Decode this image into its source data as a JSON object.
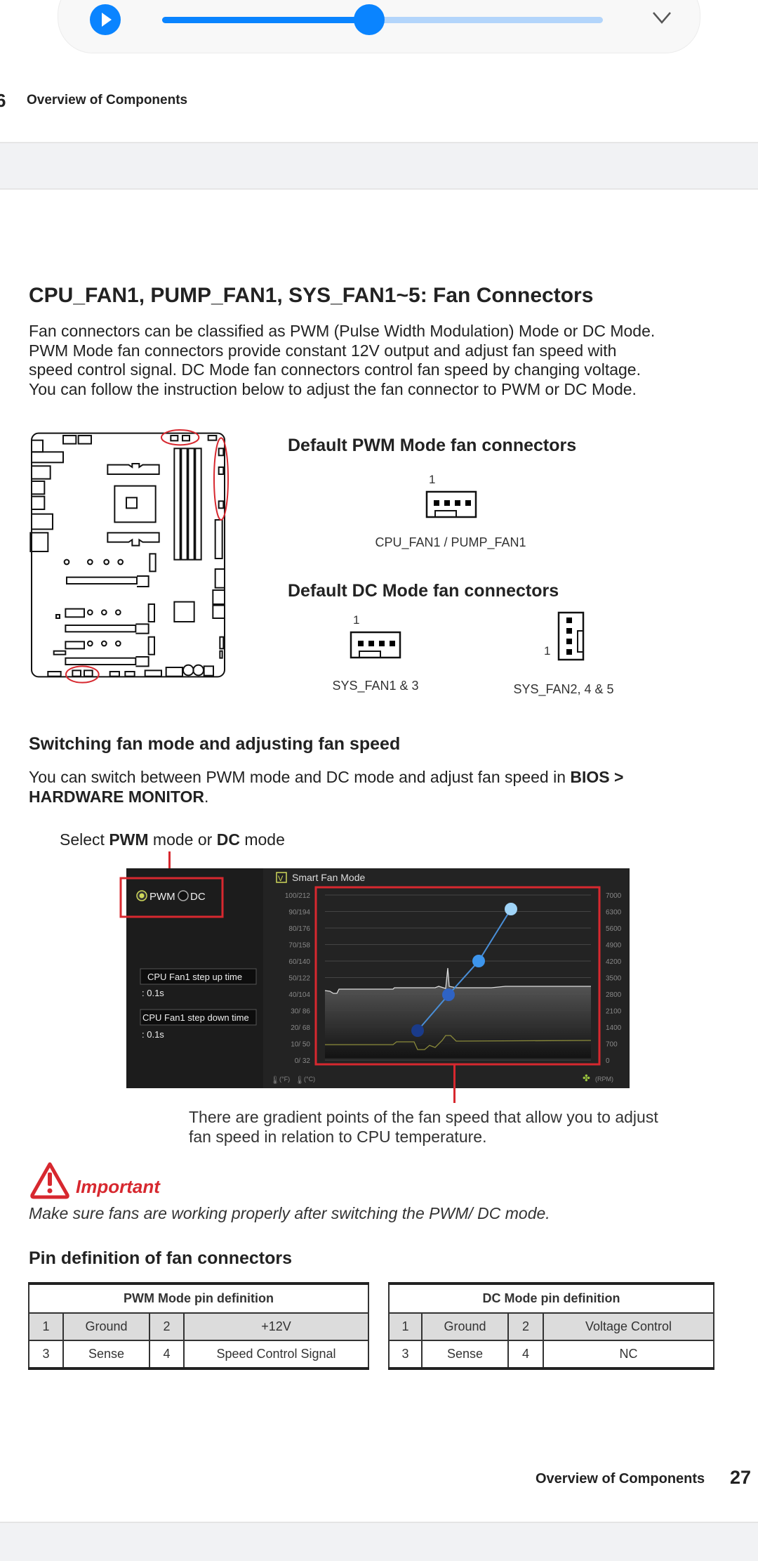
{
  "media_bar": {
    "progress_percent": 47,
    "accent": "#0a84ff"
  },
  "header": {
    "page_number": "6",
    "section": "Overview of Components"
  },
  "title": "CPU_FAN1, PUMP_FAN1, SYS_FAN1~5: Fan Connectors",
  "intro_lines": [
    "Fan connectors can be classified as PWM (Pulse Width Modulation) Mode or DC Mode.",
    "PWM Mode fan connectors provide constant 12V output and adjust fan speed with",
    "speed control signal. DC Mode fan connectors control fan speed by changing voltage.",
    "You can follow the instruction below to adjust the fan connector to PWM or DC Mode."
  ],
  "pwm_default": {
    "heading": "Default PWM Mode fan connectors",
    "pin1": "1",
    "caption": "CPU_FAN1 / PUMP_FAN1"
  },
  "dc_default": {
    "heading": "Default DC Mode fan connectors",
    "horizontal": {
      "pin1": "1",
      "caption": "SYS_FAN1 & 3"
    },
    "vertical": {
      "pin1": "1",
      "caption": "SYS_FAN2, 4 & 5"
    }
  },
  "switching": {
    "heading": "Switching fan mode and adjusting fan speed",
    "line1_pre": "You can switch between PWM mode and DC mode and adjust fan speed in ",
    "line1_bold": "BIOS >",
    "line2_bold": "HARDWARE MONITOR",
    "line2_post": ".",
    "select_pre": "Select ",
    "select_b1": "PWM",
    "select_mid": " mode or ",
    "select_b2": "DC",
    "select_post": " mode",
    "caption_lines": [
      "There are gradient points of the fan speed that allow you to adjust",
      "fan speed in relation to CPU temperature."
    ]
  },
  "bios": {
    "pwm_label": "PWM",
    "dc_label": "DC",
    "selected_mode": "PWM",
    "smart_fan_check": "V",
    "smart_fan_label": "Smart Fan Mode",
    "step_up_label": "CPU Fan1 step up time",
    "step_up_value": ": 0.1s",
    "step_down_label": "CPU Fan1 step down time",
    "step_down_value": ": 0.1s",
    "left_axis": [
      "100/212",
      "90/194",
      "80/176",
      "70/158",
      "60/140",
      "50/122",
      "40/104",
      "30/ 86",
      "20/ 68",
      "10/ 50",
      "0/ 32"
    ],
    "right_axis": [
      "7000",
      "6300",
      "5600",
      "4900",
      "4200",
      "3500",
      "2800",
      "2100",
      "1400",
      "700",
      "0"
    ],
    "unit_f": "(°F)",
    "unit_c": "(°C)",
    "unit_rpm": "(RPM)"
  },
  "important": {
    "label": "Important",
    "text": "Make sure fans are working properly after switching the PWM/ DC mode.",
    "color": "#d7282f"
  },
  "pin_definition": {
    "heading": "Pin definition of fan connectors",
    "pwm": {
      "title": "PWM Mode pin definition",
      "rows": [
        [
          "1",
          "Ground",
          "2",
          "+12V"
        ],
        [
          "3",
          "Sense",
          "4",
          "Speed Control Signal"
        ]
      ]
    },
    "dc": {
      "title": "DC Mode pin definition",
      "rows": [
        [
          "1",
          "Ground",
          "2",
          "Voltage Control"
        ],
        [
          "3",
          "Sense",
          "4",
          "NC"
        ]
      ]
    }
  },
  "footer": {
    "section": "Overview of Components",
    "page_number": "27"
  }
}
